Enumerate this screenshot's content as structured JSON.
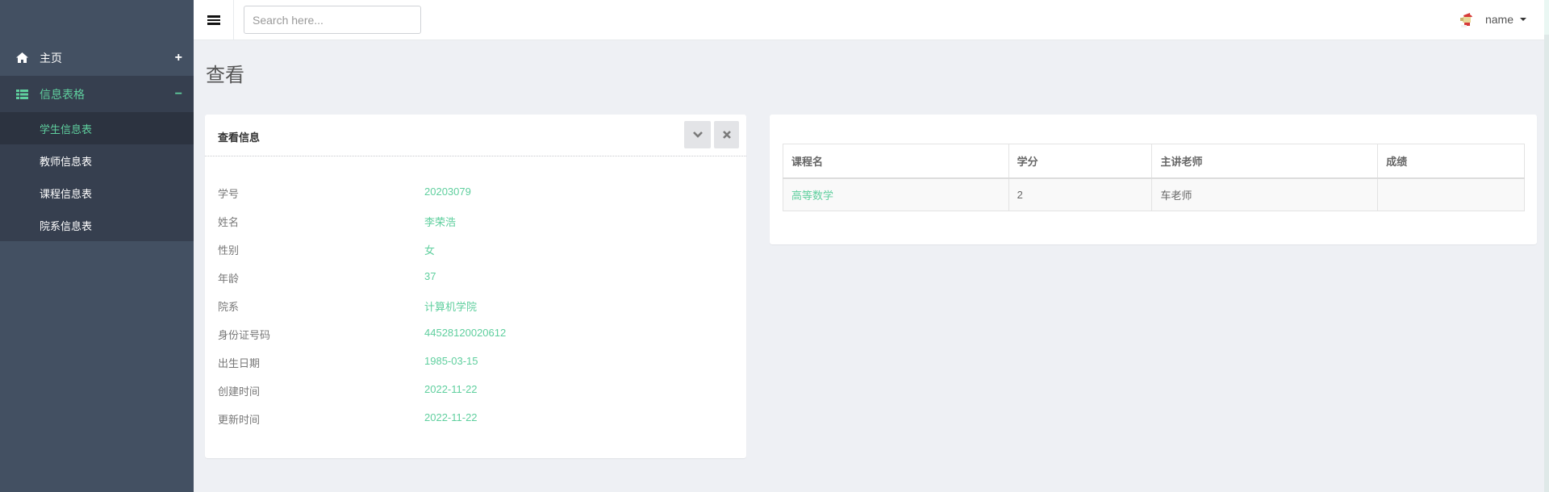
{
  "sidebar": {
    "home": {
      "label": "主页",
      "icon": "home-icon",
      "toggle": "+"
    },
    "tables": {
      "label": "信息表格",
      "icon": "table-icon",
      "toggle": "−"
    },
    "sub_items": [
      {
        "label": "学生信息表",
        "active": true
      },
      {
        "label": "教师信息表",
        "active": false
      },
      {
        "label": "课程信息表",
        "active": false
      },
      {
        "label": "院系信息表",
        "active": false
      }
    ]
  },
  "topbar": {
    "search_placeholder": "Search here...",
    "user_name": "name"
  },
  "page": {
    "title": "查看"
  },
  "info_panel": {
    "title": "查看信息",
    "rows": [
      {
        "key": "学号",
        "value": "20203079"
      },
      {
        "key": "姓名",
        "value": "李荣浩"
      },
      {
        "key": "性别",
        "value": "女"
      },
      {
        "key": "年龄",
        "value": "37"
      },
      {
        "key": "院系",
        "value": "计算机学院"
      },
      {
        "key": "身份证号码",
        "value": "44528120020612"
      },
      {
        "key": "出生日期",
        "value": "1985-03-15"
      },
      {
        "key": "创建时间",
        "value": "2022-11-22"
      },
      {
        "key": "更新时间",
        "value": "2022-11-22"
      }
    ]
  },
  "course_table": {
    "headers": [
      "课程名",
      "学分",
      "主讲老师",
      "成绩"
    ],
    "rows": [
      {
        "course": "高等数学",
        "credit": "2",
        "teacher": "车老师",
        "score": ""
      }
    ]
  },
  "colors": {
    "accent": "#5fcf9e",
    "sidebar_bg": "#435062",
    "sidebar_active_bg": "#2c3340",
    "page_bg": "#eef0f4"
  }
}
